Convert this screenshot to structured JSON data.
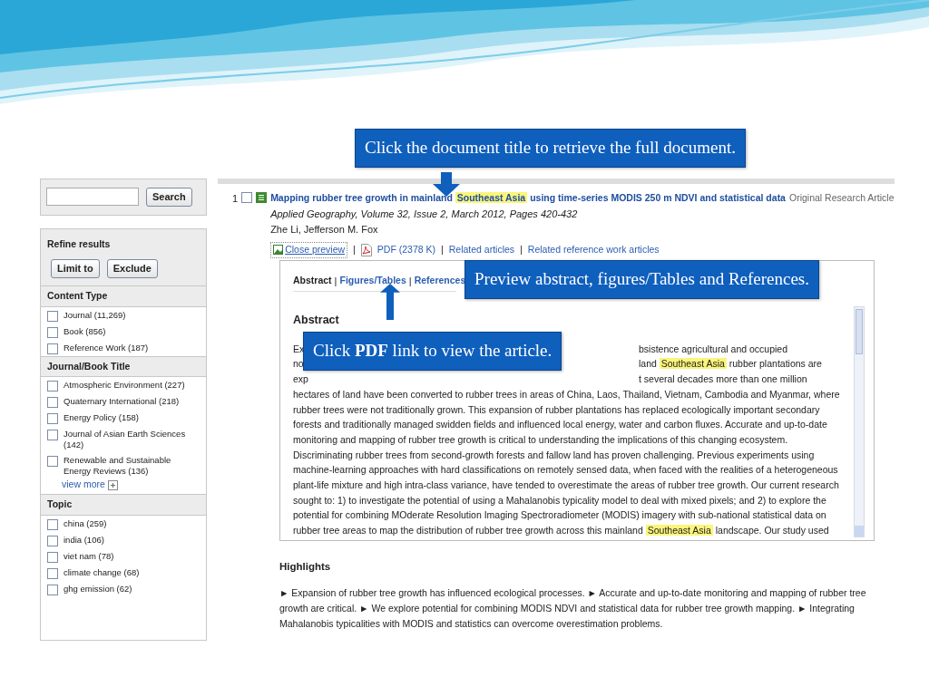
{
  "search": {
    "button": "Search"
  },
  "refine": {
    "title": "Refine results",
    "buttons": [
      "Limit to",
      "Exclude"
    ],
    "groups": [
      {
        "title": "Content Type",
        "items": [
          {
            "label": "Journal (11,269)",
            "checked": false
          },
          {
            "label": "Book (856)",
            "checked": false
          },
          {
            "label": "Reference Work (187)",
            "checked": false
          }
        ]
      },
      {
        "title": "Journal/Book Title",
        "items": [
          {
            "label": "Atmospheric Environment (227)",
            "checked": false
          },
          {
            "label": "Quaternary International (218)",
            "checked": false
          },
          {
            "label": "Energy Policy (158)",
            "checked": false
          },
          {
            "label": "Journal of Asian Earth Sciences (142)",
            "checked": false
          },
          {
            "label": "Renewable and Sustainable Energy Reviews (136)",
            "checked": false
          }
        ],
        "more": "view more"
      },
      {
        "title": "Topic",
        "items": [
          {
            "label": "china (259)",
            "checked": false
          },
          {
            "label": "india (106)",
            "checked": false
          },
          {
            "label": "viet nam (78)",
            "checked": false
          },
          {
            "label": "climate change (68)",
            "checked": false
          },
          {
            "label": "ghg emission (62)",
            "checked": false
          }
        ]
      }
    ]
  },
  "result": {
    "number": "1",
    "checked": false,
    "title_parts": [
      {
        "text": "Mapping rubber tree growth in mainland",
        "highlight": false
      },
      {
        "text": "Southeast Asia",
        "highlight": true
      },
      {
        "text": "using time-series MODIS 250 m NDVI and statistical data",
        "highlight": false
      }
    ],
    "article_type": "Original Research Article",
    "source": "Applied Geography, Volume 32, Issue 2, March 2012, Pages 420-432",
    "authors": "Zhe Li, Jefferson M. Fox",
    "separator": "|",
    "links": [
      {
        "kind": "preview",
        "label": "Close preview"
      },
      {
        "kind": "pdf",
        "label": "PDF (2378 K)"
      },
      {
        "kind": "plain",
        "label": "Related articles"
      },
      {
        "kind": "plain",
        "label": "Related reference work articles"
      }
    ]
  },
  "preview": {
    "separator": "|",
    "tabs": [
      {
        "label": "Abstract",
        "selected": true
      },
      {
        "label": "Figures/Tables",
        "selected": false
      },
      {
        "label": "References",
        "selected": false
      }
    ],
    "heading": "Abstract",
    "lines": [
      {
        "segments": [
          [
            {
              "text": "Ex",
              "highlight": false
            }
          ],
          [
            {
              "text": "bsistence agricultural and occupied",
              "highlight": false
            }
          ]
        ]
      },
      {
        "segments": [
          [
            {
              "text": "no",
              "highlight": false
            }
          ],
          [
            {
              "text": "land",
              "highlight": false
            },
            {
              "text": "Southeast Asia",
              "highlight": true
            },
            {
              "text": "rubber plantations are",
              "highlight": false
            }
          ]
        ]
      },
      {
        "segments": [
          [
            {
              "text": "exp",
              "highlight": false
            }
          ],
          [
            {
              "text": "t several decades more than one million",
              "highlight": false
            }
          ]
        ]
      },
      {
        "segments": [
          [
            {
              "text": "hectares of land have been converted to rubber trees in areas of China, Laos, Thailand, Vietnam, Cambodia and Myanmar, where",
              "highlight": false
            }
          ]
        ]
      },
      {
        "segments": [
          [
            {
              "text": "rubber trees were not traditionally grown. This expansion of rubber plantations has replaced ecologically important secondary",
              "highlight": false
            }
          ]
        ]
      },
      {
        "segments": [
          [
            {
              "text": "forests and traditionally managed swidden fields and influenced local energy, water and carbon fluxes. Accurate and up-to-date",
              "highlight": false
            }
          ]
        ]
      },
      {
        "segments": [
          [
            {
              "text": "monitoring and mapping of rubber tree growth is critical to understanding the implications of this changing ecosystem.",
              "highlight": false
            }
          ]
        ]
      },
      {
        "segments": [
          [
            {
              "text": "Discriminating rubber trees from second-growth forests and fallow land has proven challenging. Previous experiments using",
              "highlight": false
            }
          ]
        ]
      },
      {
        "segments": [
          [
            {
              "text": "machine-learning approaches with hard classifications on remotely sensed data, when faced with the realities of a heterogeneous",
              "highlight": false
            }
          ]
        ]
      },
      {
        "segments": [
          [
            {
              "text": "plant-life mixture and high intra-class variance, have tended to overestimate the areas of rubber tree growth. Our current research",
              "highlight": false
            }
          ]
        ]
      },
      {
        "segments": [
          [
            {
              "text": "sought to: 1) to investigate the potential of using a Mahalanobis typicality model to deal with mixed pixels; and 2) to explore the",
              "highlight": false
            }
          ]
        ]
      },
      {
        "segments": [
          [
            {
              "text": "potential for combining MOderate Resolution Imaging Spectroradiometer (MODIS) imagery with sub-national statistical data on",
              "highlight": false
            }
          ]
        ]
      },
      {
        "segments": [
          [
            {
              "text": "rubber tree areas to map the distribution of rubber tree growth across this mainland",
              "highlight": false
            },
            {
              "text": "Southeast Asia",
              "highlight": true
            },
            {
              "text": "landscape. Our study used",
              "highlight": false
            }
          ]
        ]
      }
    ]
  },
  "highlights": {
    "heading": "Highlights",
    "lines": [
      "► Expansion of rubber tree growth has influenced ecological processes. ► Accurate and up-to-date monitoring and mapping of rubber tree",
      "growth are critical. ► We explore potential for combining MODIS NDVI and statistical data for rubber tree growth mapping. ► Integrating",
      "Mahalanobis typicalities with MODIS and statistics can overcome overestimation problems."
    ]
  },
  "callouts": [
    {
      "text": "Click the document title to retrieve the full document.",
      "kind": "down"
    },
    {
      "text": "Preview abstract, figures/Tables and References.",
      "kind": "plain"
    },
    {
      "text": "Click **PDF** link to view the article.",
      "kind": "up"
    }
  ]
}
